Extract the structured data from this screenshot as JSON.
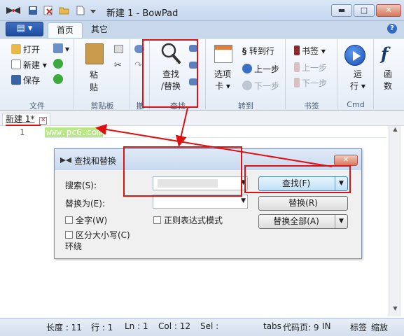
{
  "window": {
    "title": "新建 1 - BowPad"
  },
  "ribbon": {
    "tabs": [
      "首页",
      "其它"
    ],
    "clipboard_group": {
      "open": "打开",
      "new": "新建",
      "save": "保存",
      "paste": "粘\n贴"
    },
    "groups": [
      "文件",
      "剪贴板",
      "撤",
      "查找",
      "转到",
      "书签",
      "Cmd"
    ],
    "find": {
      "label_line1": "查找",
      "label_line2": "/替换"
    },
    "goto": {
      "tabs_label_l1": "选项",
      "tabs_label_l2": "卡",
      "goto_line": "转到行",
      "prev_step": "上一步",
      "next_step": "下一步"
    },
    "bookmarks": {
      "bookmark": "书签",
      "prev": "上一步",
      "next": "下一步"
    },
    "cmd": {
      "run_l1": "运",
      "run_l2": "行"
    },
    "partial": {
      "fn_label": "函",
      "fn_label2": "数"
    }
  },
  "editor": {
    "tab_label": "新建 1*",
    "line_number": "1",
    "line_text": "www.pc6.com"
  },
  "dialog": {
    "title": "查找和替换",
    "search_label": "搜索(S):",
    "replace_label": "替换为(E):",
    "whole_word": "全字(W)",
    "match_case": "区分大小写(C)",
    "wrap": "环绕",
    "regex": "正则表达式模式",
    "find_button": "查找(F)",
    "replace_button": "替换(R)",
    "replace_all_button": "替换全部(A)"
  },
  "status": {
    "length": "长度 : 11",
    "line": "行 : 1",
    "ln": "Ln : 1",
    "col": "Col : 12",
    "sel": "Sel :",
    "tabs": "tabs",
    "codepage": "代码页: 9",
    "ins": "IN",
    "label": "标签",
    "zoom": "缩放"
  },
  "colors": {
    "annotation_red": "#e01010",
    "highlight_text": "#b8e986",
    "ribbon_blue": "#1f4c9e"
  }
}
